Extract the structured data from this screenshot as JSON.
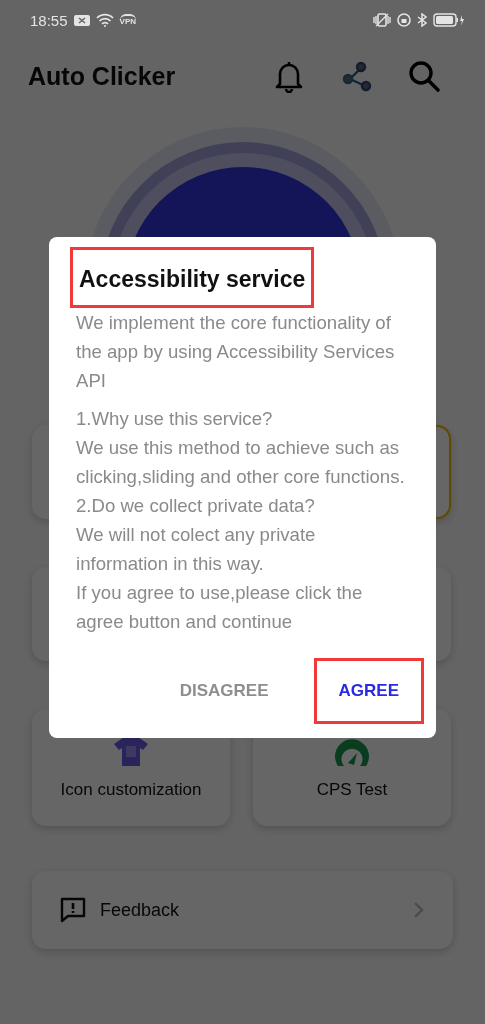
{
  "status_bar": {
    "time": "18:55",
    "vpn": "VPN"
  },
  "header": {
    "title": "Auto Clicker"
  },
  "feature_cards": [
    {
      "kind": "covered",
      "selected": false
    },
    {
      "kind": "covered",
      "selected": true
    },
    {
      "kind": "covered",
      "selected": false
    },
    {
      "kind": "covered",
      "selected": false
    },
    {
      "kind": "customize",
      "label": "Icon customization",
      "selected": false
    },
    {
      "kind": "speedtest",
      "label": "CPS Test",
      "selected": false
    }
  ],
  "list_items": [
    {
      "label": "Feedback"
    }
  ],
  "dialog": {
    "title": "Accessibility service",
    "title_highlighted": true,
    "paragraphs": [
      [
        "We implement the core functionality of the app by using Accessibility Services API"
      ],
      [
        "1.Why use this service?",
        "We use this method to achieve such as clicking,sliding and other core functions.",
        "2.Do we collect private data?",
        "We will not colect any private information in this way.",
        "If you agree to use,please click the agree button and continue"
      ]
    ],
    "buttons": [
      {
        "label": "DISAGREE",
        "kind": "secondary",
        "highlighted": false
      },
      {
        "label": "AGREE",
        "kind": "primary",
        "highlighted": true
      }
    ]
  }
}
